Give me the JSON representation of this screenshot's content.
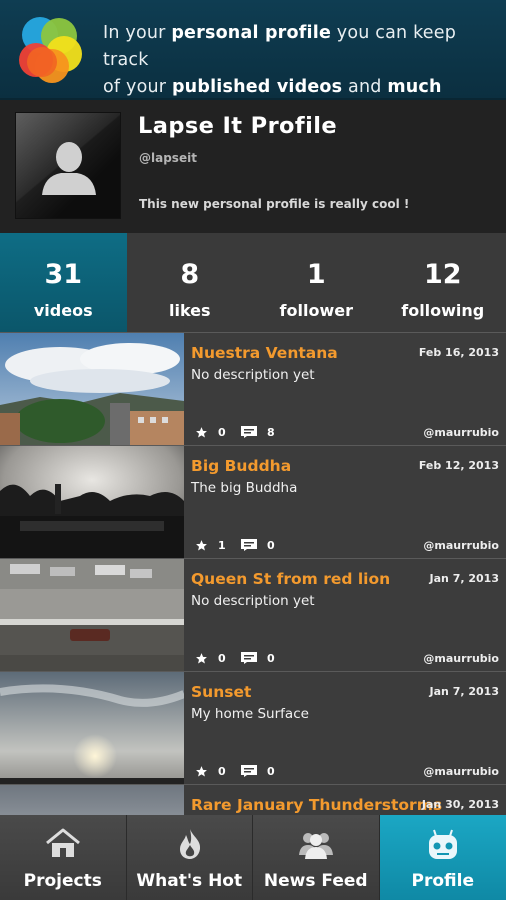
{
  "banner": {
    "t1": "In your ",
    "b1": "personal profile",
    "t2": " you can keep track",
    "t3": "of your ",
    "b2": "published videos",
    "t4": " and ",
    "b3": "much more",
    "t5": " !"
  },
  "profile": {
    "name": "Lapse It Profile",
    "handle": "@lapseit",
    "bio": "This new personal profile is really cool !"
  },
  "stats": [
    {
      "value": "31",
      "label": "videos"
    },
    {
      "value": "8",
      "label": "likes"
    },
    {
      "value": "1",
      "label": "follower"
    },
    {
      "value": "12",
      "label": "following"
    }
  ],
  "videos": [
    {
      "title": "Nuestra Ventana",
      "date": "Feb 16, 2013",
      "description": "No description yet",
      "likes": "0",
      "comments": "8",
      "user": "@maurrubio"
    },
    {
      "title": "Big Buddha",
      "date": "Feb 12, 2013",
      "description": "The big Buddha",
      "likes": "1",
      "comments": "0",
      "user": "@maurrubio"
    },
    {
      "title": "Queen St from red lion",
      "date": "Jan 7, 2013",
      "description": "No description yet",
      "likes": "0",
      "comments": "0",
      "user": "@maurrubio"
    },
    {
      "title": "Sunset",
      "date": "Jan 7, 2013",
      "description": "My home Surface",
      "likes": "0",
      "comments": "0",
      "user": "@maurrubio"
    },
    {
      "title": "Rare January Thunderstorms",
      "date": "Jan 30, 2013",
      "description": "",
      "likes": "",
      "comments": "",
      "user": ""
    }
  ],
  "tabs": [
    {
      "label": "Projects",
      "icon": "house-icon"
    },
    {
      "label": "What's Hot",
      "icon": "flame-icon"
    },
    {
      "label": "News Feed",
      "icon": "people-icon"
    },
    {
      "label": "Profile",
      "icon": "robot-icon"
    }
  ],
  "colors": {
    "accent": "#f39a2e",
    "active_tab": "#1ba7c4",
    "banner": "#0f3d52"
  }
}
